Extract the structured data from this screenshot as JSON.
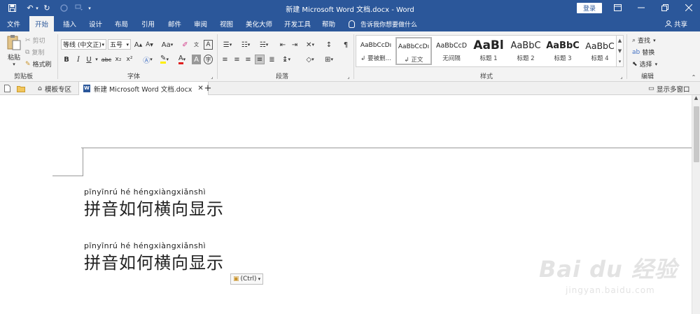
{
  "window": {
    "title": "新建 Microsoft Word 文档.docx - Word",
    "login_label": "登录"
  },
  "tabs": [
    {
      "label": "文件"
    },
    {
      "label": "开始"
    },
    {
      "label": "插入"
    },
    {
      "label": "设计"
    },
    {
      "label": "布局"
    },
    {
      "label": "引用"
    },
    {
      "label": "邮件"
    },
    {
      "label": "审阅"
    },
    {
      "label": "视图"
    },
    {
      "label": "美化大师"
    },
    {
      "label": "开发工具"
    },
    {
      "label": "帮助"
    }
  ],
  "tell_me": "告诉我你想要做什么",
  "share_label": "共享",
  "ribbon": {
    "clipboard": {
      "label": "剪贴板",
      "paste": "粘贴",
      "cut": "剪切",
      "copy": "复制",
      "format_painter": "格式刷"
    },
    "font": {
      "label": "字体",
      "font_name": "等线 (中文正)",
      "font_size": "五号",
      "bold": "B",
      "italic": "I",
      "underline": "U",
      "strike": "abc",
      "subscript": "x₂",
      "superscript": "x²",
      "font_color": "A",
      "clear_format": "Aa"
    },
    "paragraph": {
      "label": "段落"
    },
    "styles": {
      "label": "样式",
      "items": [
        {
          "sample": "AaBbCcDı",
          "name": "↲ 要被删..."
        },
        {
          "sample": "AaBbCcDı",
          "name": "↲ 正文"
        },
        {
          "sample": "AaBbCcD",
          "name": "无间隔"
        },
        {
          "sample": "AaBl",
          "name": "标题 1"
        },
        {
          "sample": "AaBbC",
          "name": "标题 2"
        },
        {
          "sample": "AaBbC",
          "name": "标题 3"
        },
        {
          "sample": "AaBbC",
          "name": "标题 4"
        }
      ]
    },
    "editing": {
      "label": "编辑",
      "find": "查找",
      "replace": "替换",
      "select": "选择"
    }
  },
  "doc_tabs": {
    "template_tab": "模板专区",
    "doc_tab": "新建 Microsoft Word 文档.docx",
    "multi_window": "显示多窗口"
  },
  "document": {
    "lines": [
      {
        "pinyin": "pīnyīnrú hé héngxiàngxiǎnshì",
        "text": "拼音如何横向显示"
      },
      {
        "pinyin": "pīnyīnrú hé héngxiàngxiǎnshì",
        "text": "拼音如何横向显示"
      }
    ],
    "paste_option": "(Ctrl)"
  },
  "watermark": {
    "main": "Bai du 经验",
    "sub": "jingyan.baidu.com"
  }
}
